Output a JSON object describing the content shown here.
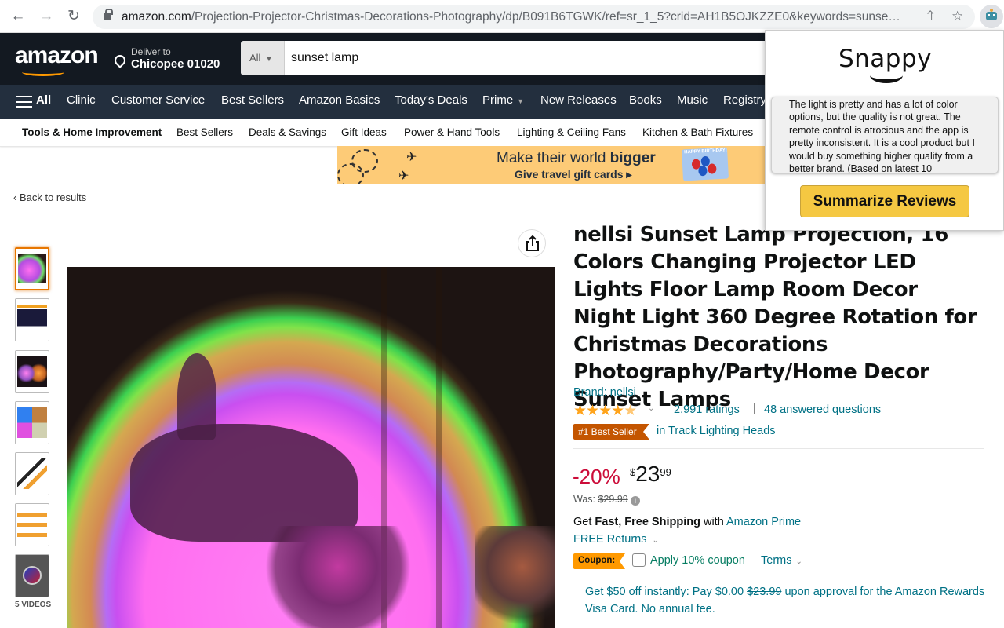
{
  "browser": {
    "url_host": "amazon.com",
    "url_path": "/Projection-Projector-Christmas-Decorations-Photography/dp/B091B6TGWK/ref=sr_1_5?crid=AH1B5OJKZZE0&keywords=sunse…",
    "back_icon": "←",
    "forward_icon": "→",
    "reload_icon": "↻",
    "share_icon": "⇧",
    "bookmark_icon": "☆"
  },
  "header": {
    "logo": "amazon",
    "deliver_to_label": "Deliver to",
    "deliver_location": "Chicopee 01020",
    "search_dept": "All",
    "search_value": "sunset lamp"
  },
  "nav": {
    "all_label": "All",
    "items": [
      "Clinic",
      "Customer Service",
      "Best Sellers",
      "Amazon Basics",
      "Today's Deals",
      "Prime",
      "New Releases",
      "Books",
      "Music",
      "Registry"
    ]
  },
  "subnav": {
    "items": [
      "Tools & Home Improvement",
      "Best Sellers",
      "Deals & Savings",
      "Gift Ideas",
      "Power & Hand Tools",
      "Lighting & Ceiling Fans",
      "Kitchen & Bath Fixtures"
    ]
  },
  "banner": {
    "line1_prefix": "Make their world ",
    "line1_bold": "bigger",
    "line2": "Give travel gift cards ▸",
    "card_text": "HAPPY BIRTHDAY!"
  },
  "back_link": "‹ Back to results",
  "gallery": {
    "thumbnail_count": 7,
    "videos_label": "5 VIDEOS"
  },
  "product": {
    "title": "nellsi Sunset Lamp Projection, 16 Colors Changing Projector LED Lights Floor Lamp Room Decor Night Light 360 Degree Rotation for Christmas Decorations Photography/Party/Home Decor Sunset Lamps",
    "brand": "Brand: nellsi",
    "rating_stars": 4.5,
    "stars_display": "★★★★",
    "ratings_count": "2,991 ratings",
    "separator": "|",
    "answered_questions": "48 answered questions",
    "best_seller_badge": "#1 Best Seller",
    "best_seller_category": "in Track Lighting Heads",
    "discount": "-20%",
    "price_symbol": "$",
    "price_whole": "23",
    "price_fraction": "99",
    "was_label": "Was: ",
    "was_price": "$29.99",
    "shipping_prefix": "Get ",
    "shipping_bold": "Fast, Free Shipping",
    "shipping_mid": " with ",
    "shipping_link": "Amazon Prime",
    "returns": "FREE Returns",
    "coupon_badge": "Coupon:",
    "coupon_text": "Apply 10% coupon",
    "coupon_checked": false,
    "terms": "Terms",
    "promo_prefix": "Get $50 off instantly: Pay $0.00 ",
    "promo_strike": "$23.99",
    "promo_suffix": " upon approval for the Amazon Rewards Visa Card. No annual fee."
  },
  "extension": {
    "name": "Snappy",
    "summary": "The light is pretty and has a lot of color options, but the quality is not great. The remote control is atrocious and the app is pretty inconsistent. It is a cool product but I would buy something higher quality from a better brand. (Based on latest 10",
    "button_label": "Summarize Reviews"
  }
}
